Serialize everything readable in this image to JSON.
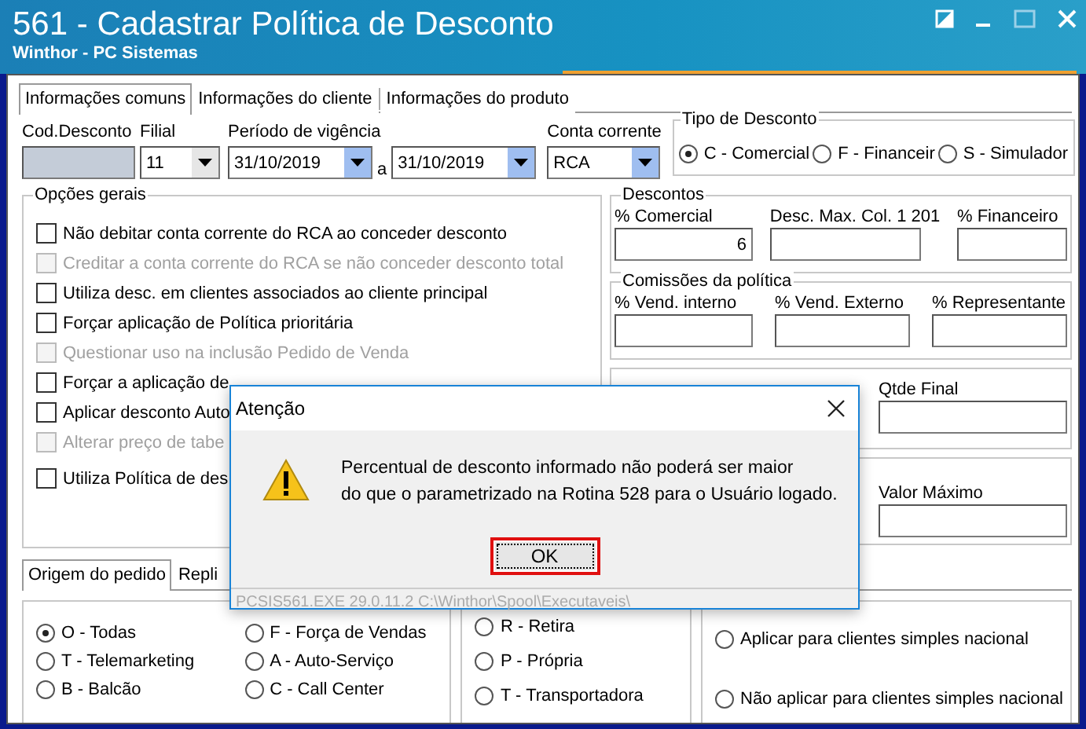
{
  "window": {
    "title": "561 - Cadastrar Política de Desconto",
    "subtitle": "Winthor - PC Sistemas"
  },
  "tabs": [
    {
      "label": "Informações comuns",
      "selected": true
    },
    {
      "label": "Informações do cliente",
      "selected": false
    },
    {
      "label": "Informações do produto",
      "selected": false
    }
  ],
  "header": {
    "cod_desconto": {
      "label": "Cod.Desconto",
      "disabled": true
    },
    "filial": {
      "label": "Filial",
      "value": "11"
    },
    "periodo": {
      "label": "Período de vigência",
      "from": "31/10/2019",
      "separator": "a",
      "to": "31/10/2019"
    },
    "conta_corrente": {
      "label": "Conta corrente",
      "value": "RCA"
    }
  },
  "tipo_desconto": {
    "title": "Tipo de Desconto",
    "options": [
      {
        "label": "C - Comercial",
        "selected": true
      },
      {
        "label": "F - Financeir",
        "selected": false
      },
      {
        "label": "S - Simulador",
        "selected": false
      }
    ]
  },
  "opcoes_gerais": {
    "title": "Opções gerais",
    "items": [
      {
        "label": "Não debitar conta corrente do RCA ao conceder desconto",
        "checked": false,
        "disabled": false
      },
      {
        "label": "Creditar a conta corrente do RCA se não conceder desconto total",
        "checked": false,
        "disabled": true
      },
      {
        "label": "Utiliza desc. em clientes associados ao cliente principal",
        "checked": false,
        "disabled": false
      },
      {
        "label": "Forçar aplicação de Política prioritária",
        "checked": false,
        "disabled": false
      },
      {
        "label": "Questionar uso na inclusão Pedido de Venda",
        "checked": false,
        "disabled": true
      },
      {
        "label": "Forçar a aplicação de",
        "checked": false,
        "disabled": false
      },
      {
        "label": "Aplicar desconto Auto",
        "checked": false,
        "disabled": false
      },
      {
        "label": "Alterar preço de tabe",
        "checked": false,
        "disabled": true
      },
      {
        "label": "Utiliza Política de des",
        "checked": false,
        "disabled": false
      }
    ]
  },
  "descontos": {
    "title": "Descontos",
    "fields": [
      {
        "label": "% Comercial",
        "value": "6"
      },
      {
        "label": "Desc. Max. Col. 1 201"
      },
      {
        "label": "% Financeiro"
      }
    ]
  },
  "comissoes": {
    "title": "Comissões da política",
    "fields": [
      {
        "label": "% Vend. interno"
      },
      {
        "label": "% Vend. Externo"
      },
      {
        "label": "% Representante"
      }
    ]
  },
  "quantidade": {
    "fields": [
      {
        "label": "Qtde Final"
      }
    ]
  },
  "valor": {
    "fields": [
      {
        "label": "Valor Máximo"
      }
    ]
  },
  "bottom_tabs": [
    {
      "label": "Origem do pedido",
      "selected": true
    },
    {
      "label": "Repli",
      "selected": false
    }
  ],
  "origem_pedido": {
    "options": [
      {
        "label": "O - Todas",
        "selected": true
      },
      {
        "label": "F - Força de Vendas",
        "selected": false
      },
      {
        "label": "T - Telemarketing",
        "selected": false
      },
      {
        "label": "A - Auto-Serviço",
        "selected": false
      },
      {
        "label": "B - Balcão",
        "selected": false
      },
      {
        "label": "C - Call Center",
        "selected": false
      }
    ]
  },
  "tipo_entrega": {
    "options": [
      {
        "label": "R - Retira",
        "selected": false
      },
      {
        "label": "P - Própria",
        "selected": false
      },
      {
        "label": "T - Transportadora",
        "selected": false
      }
    ]
  },
  "clientes_simples": {
    "options": [
      {
        "label": "Aplicar para clientes simples nacional",
        "selected": false
      },
      {
        "label": "Não aplicar para clientes simples nacional",
        "selected": false
      }
    ]
  },
  "dialog": {
    "title": "Atenção",
    "message_lines": [
      "Percentual de desconto informado não poderá ser maior",
      "do que o parametrizado na Rotina 528 para o Usuário logado."
    ],
    "button": "OK",
    "footer": "PCSIS561.EXE 29.0.11.2 C:\\Winthor\\Spool\\Executaveis\\"
  }
}
